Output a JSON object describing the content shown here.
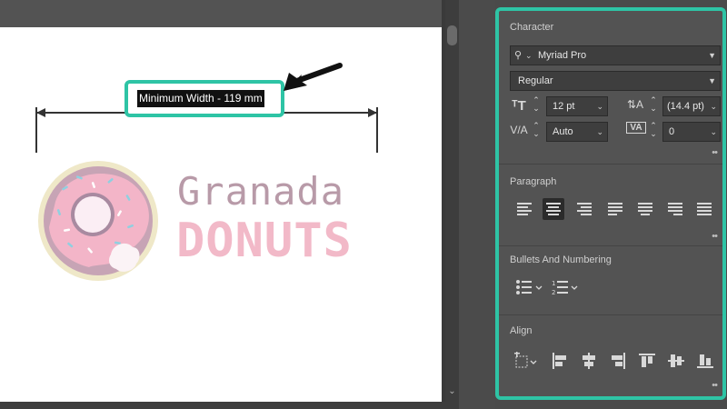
{
  "canvas": {
    "measurement_label": "Minimum Width - 119 mm",
    "brand_line_1": "Granada",
    "brand_line_2": "DONUTS"
  },
  "panel": {
    "character": {
      "title": "Character",
      "font_family": "Myriad Pro",
      "font_style": "Regular",
      "font_size": "12 pt",
      "leading": "(14.4 pt)",
      "kerning": "Auto",
      "tracking": "0"
    },
    "paragraph": {
      "title": "Paragraph"
    },
    "bullets": {
      "title": "Bullets And Numbering"
    },
    "align": {
      "title": "Align"
    },
    "more_label": "••"
  },
  "colors": {
    "accent": "#2ec4a5",
    "panel_bg": "#535353",
    "brand_pink": "#f2b9c8",
    "brand_mauve": "#b89aa8"
  }
}
